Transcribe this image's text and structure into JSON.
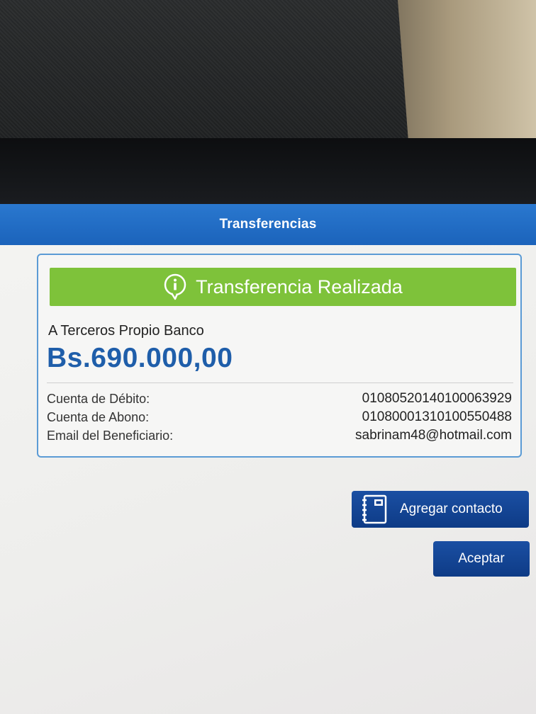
{
  "navbar": {
    "title": "Transferencias"
  },
  "receipt": {
    "status": "Transferencia Realizada",
    "transfer_type": "A Terceros Propio Banco",
    "amount": "Bs.690.000,00",
    "details": [
      {
        "label": "Cuenta de Débito:",
        "value": "01080520140100063929"
      },
      {
        "label": "Cuenta de Abono:",
        "value": "01080001310100550488"
      },
      {
        "label": "Email del Beneficiario:",
        "value": "sabrinam48@hotmail.com"
      }
    ]
  },
  "actions": {
    "add_contact_label": "Agregar contacto",
    "accept_label": "Aceptar"
  },
  "icons": {
    "status": "info-icon",
    "add_contact": "address-book-icon"
  },
  "colors": {
    "navbar": "#1f6ac2",
    "success_banner": "#7ec23a",
    "amount": "#1f5eaa",
    "card_border": "#5b9bd5",
    "button": "#133f8c"
  }
}
